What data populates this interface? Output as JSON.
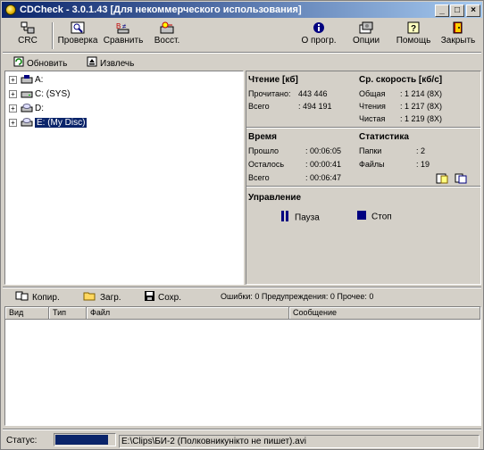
{
  "window": {
    "title": "CDCheck - 3.0.1.43 [Для некоммерческого использования]"
  },
  "caption_buttons": {
    "minimize": "_",
    "maximize": "□",
    "close": "×"
  },
  "toolbar": {
    "crc": "CRC",
    "verify": "Проверка",
    "compare": "Сравнить",
    "restore": "Восст.",
    "about": "О прогр.",
    "options": "Опции",
    "help": "Помощь",
    "close": "Закрыть"
  },
  "subtoolbar": {
    "refresh": "Обновить",
    "extract": "Извлечь"
  },
  "tree": {
    "items": [
      {
        "label": "A:",
        "icon": "floppy-drive-icon"
      },
      {
        "label": "C: (SYS)",
        "icon": "hard-drive-icon"
      },
      {
        "label": "D:",
        "icon": "cd-drive-icon"
      },
      {
        "label": "E: (My Disc)",
        "icon": "cd-drive-icon",
        "selected": true
      }
    ]
  },
  "reading": {
    "title": "Чтение [кб]",
    "read_label": "Прочитано:",
    "read_value": "443 446",
    "total_label": "Всего",
    "total_value": ": 494 191"
  },
  "speed": {
    "title": "Ср. скорость [кб/с]",
    "overall_label": "Общая",
    "overall_value": ": 1 214 (8X)",
    "read_label": "Чтения",
    "read_value": ": 1 217 (8X)",
    "pure_label": "Чистая",
    "pure_value": ": 1 219 (8X)"
  },
  "time": {
    "title": "Время",
    "elapsed_label": "Прошло",
    "elapsed_value": ": 00:06:05",
    "remaining_label": "Осталось",
    "remaining_value": ": 00:00:41",
    "total_label": "Всего",
    "total_value": ": 00:06:47"
  },
  "stats": {
    "title": "Статистика",
    "folders_label": "Папки",
    "folders_value": ": 2",
    "files_label": "Файлы",
    "files_value": ": 19"
  },
  "control": {
    "title": "Управление",
    "pause": "Пауза",
    "stop": "Стоп"
  },
  "bottom_toolbar": {
    "copy": "Копир.",
    "load": "Загр.",
    "save": "Сохр.",
    "summary": "Ошибки: 0 Предупреждения: 0 Прочее: 0"
  },
  "log_columns": [
    "Вид",
    "Тип",
    "Файл",
    "Сообщение"
  ],
  "status": {
    "label": "Статус:",
    "progress": 0.9,
    "file": "E:\\Clips\\БИ-2 (Полковникунікто не пишет).avi"
  },
  "colors": {
    "title_start": "#0a246a",
    "title_end": "#a6caf0",
    "selection": "#0a246a",
    "progress": "#0a246a"
  }
}
